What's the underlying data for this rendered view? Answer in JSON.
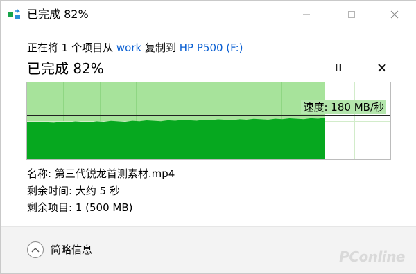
{
  "window": {
    "title": "已完成 82%",
    "icons": {
      "app": "copy-files-icon",
      "minimize": "minimize-icon",
      "maximize": "maximize-icon",
      "close": "close-icon"
    }
  },
  "operation": {
    "prefix": "正在将 1 个项目从",
    "source": "work",
    "middle": "复制到",
    "destination": "HP P500 (F:)"
  },
  "progress": {
    "label": "已完成 82%",
    "percent": 82,
    "pause_icon": "pause-icon",
    "cancel_icon": "cancel-icon",
    "speed_label": "速度: 180 MB/秒"
  },
  "details": {
    "name_label": "名称: 第三代锐龙首测素材.mp4",
    "time_label": "剩余时间: 大约 5 秒",
    "items_label": "剩余项目: 1 (500 MB)"
  },
  "footer": {
    "toggle_icon": "chevron-up-icon",
    "label": "简略信息"
  },
  "colors": {
    "progress_fill": "#a7e39b",
    "speed_fill": "#06a81f",
    "link": "#0a5fd2",
    "footer_bg": "#f3f3f3"
  },
  "watermark": "PConline"
}
